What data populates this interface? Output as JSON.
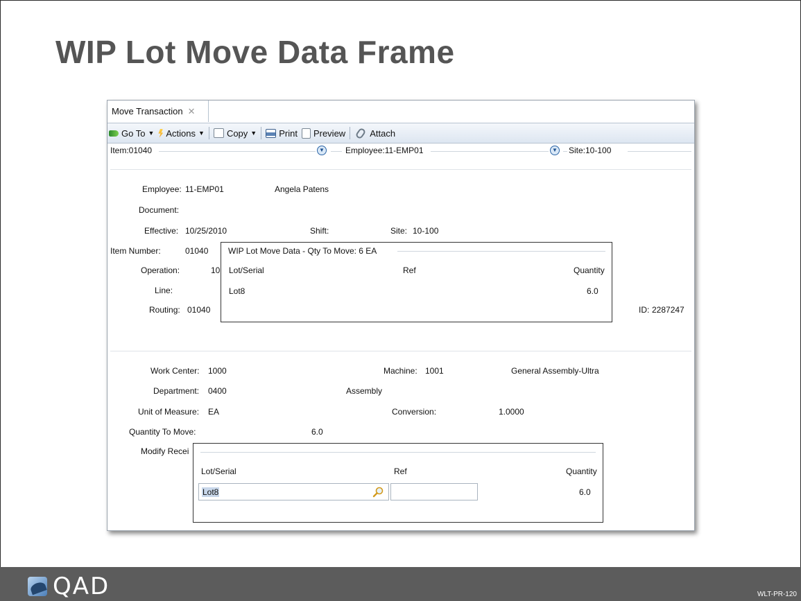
{
  "slide": {
    "title": "WIP Lot Move Data Frame",
    "logo_text": "QAD",
    "code": "WLT-PR-120"
  },
  "tab": {
    "label": "Move Transaction",
    "close_icon": "close-icon"
  },
  "toolbar": {
    "goto": "Go To",
    "actions": "Actions",
    "copy": "Copy",
    "print": "Print",
    "preview": "Preview",
    "attach": "Attach"
  },
  "summary": {
    "item": "Item:01040",
    "employee": "Employee:11-EMP01",
    "site": "Site:10-100"
  },
  "header_fields": {
    "employee_label": "Employee:",
    "employee_value": "11-EMP01",
    "employee_name": "Angela Patens",
    "document_label": "Document:",
    "effective_label": "Effective:",
    "effective_value": "10/25/2010",
    "shift_label": "Shift:",
    "site_label": "Site:",
    "site_value": "10-100",
    "item_number_label": "Item Number:",
    "item_number_value": "01040",
    "operation_label": "Operation:",
    "operation_value_partial": "10",
    "line_label": "Line:",
    "routing_label": "Routing:",
    "routing_value": "01040",
    "id_label": "ID:",
    "id_value": "2287247"
  },
  "wip_popup": {
    "caption": "WIP Lot Move Data - Qty To Move: 6 EA",
    "columns": [
      "Lot/Serial",
      "Ref",
      "Quantity"
    ],
    "rows": [
      {
        "lot": "Lot8",
        "ref": "",
        "quantity": "6.0"
      }
    ]
  },
  "detail_fields": {
    "work_center_label": "Work Center:",
    "work_center_value": "1000",
    "machine_label": "Machine:",
    "machine_value": "1001",
    "machine_desc": "General Assembly-Ultra",
    "department_label": "Department:",
    "department_value": "0400",
    "department_desc": "Assembly",
    "uom_label": "Unit of Measure:",
    "uom_value": "EA",
    "conversion_label": "Conversion:",
    "conversion_value": "1.0000",
    "qty_to_move_label": "Quantity To Move:",
    "qty_to_move_value": "6.0",
    "modify_receipt_label_partial": "Modify Recei"
  },
  "receipt_popup": {
    "columns": [
      "Lot/Serial",
      "Ref",
      "Quantity"
    ],
    "lot_value": "Lot8",
    "ref_value": "",
    "quantity": "6.0"
  }
}
